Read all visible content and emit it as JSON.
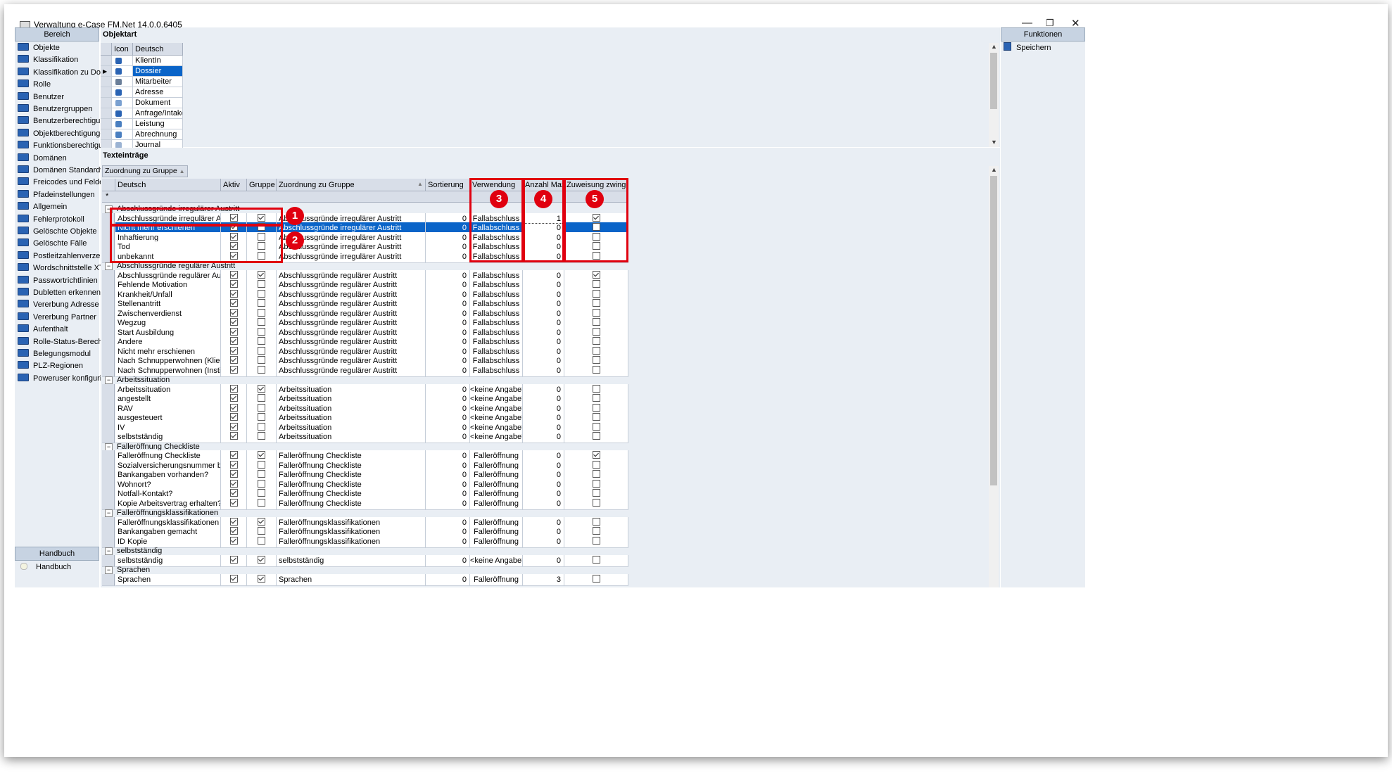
{
  "window": {
    "title": "Verwaltung e-Case FM.Net 14.0.0.6405",
    "minimize": "—",
    "restore": "❐",
    "close": "✕"
  },
  "left_panel": {
    "header": "Bereich",
    "items": [
      "Objekte",
      "Klassifikation",
      "Klassifikation zu Domä...",
      "Rolle",
      "Benutzer",
      "Benutzergruppen",
      "Benutzerberechtigungen",
      "Objektberechtigungen",
      "Funktionsberechtigung...",
      "Domänen",
      "Domänen Standardwe...",
      "Freicodes und Felder",
      "Pfadeinstellungen",
      "Allgemein",
      "Fehlerprotokoll",
      "Gelöschte Objekte",
      "Gelöschte Fälle",
      "Postleitzahlenverzeich...",
      "Wordschnittstelle XT",
      "Passwortrichtlinien",
      "Dubletten erkennen",
      "Vererbung Adresse",
      "Vererbung Partner",
      "Aufenthalt",
      "Rolle-Status-Berechnu...",
      "Belegungsmodul",
      "PLZ-Regionen",
      "Poweruser konfigurieren"
    ],
    "handbook_header": "Handbuch",
    "handbook_item": "Handbuch"
  },
  "right_panel": {
    "header": "Funktionen",
    "save": "Speichern"
  },
  "objektart": {
    "title": "Objektart",
    "columns": [
      "Icon",
      "Deutsch"
    ],
    "rows": [
      {
        "label": "KlientIn",
        "icon": "person-icon"
      },
      {
        "label": "Dossier",
        "icon": "folder-icon",
        "selected": true
      },
      {
        "label": "Mitarbeiter",
        "icon": "employee-icon"
      },
      {
        "label": "Adresse",
        "icon": "address-icon"
      },
      {
        "label": "Dokument",
        "icon": "document-icon"
      },
      {
        "label": "Anfrage/Intake",
        "icon": "pencil-icon"
      },
      {
        "label": "Leistung",
        "icon": "service-icon"
      },
      {
        "label": "Abrechnung",
        "icon": "billing-icon"
      },
      {
        "label": "Journal",
        "icon": "journal-icon"
      }
    ]
  },
  "texteintraege": {
    "title": "Texteinträge",
    "group_chip": "Zuordnung zu Gruppe",
    "new_row_marker": "*",
    "columns": [
      "Deutsch",
      "Aktiv",
      "Gruppe",
      "Zuordnung zu Gruppe",
      "Sortierung",
      "Verwendung",
      "Anzahl Max",
      "Zuweisung zwingend"
    ],
    "groups": [
      {
        "name": "Abschlussgründe irregulärer Austritt",
        "rows": [
          {
            "d": "Abschlussgründe irregulärer Austritt",
            "a": true,
            "g": true,
            "z": "Abschlussgründe irregulärer Austritt",
            "s": "0",
            "v": "Fallabschluss",
            "m": "1",
            "zw": true
          },
          {
            "d": "Nicht mehr erschienen",
            "a": true,
            "g": false,
            "z": "Abschlussgründe irregulärer Austritt",
            "s": "0",
            "v": "Fallabschluss",
            "m": "0",
            "zw": false,
            "selected": true
          },
          {
            "d": "Inhaftierung",
            "a": true,
            "g": false,
            "z": "Abschlussgründe irregulärer Austritt",
            "s": "0",
            "v": "Fallabschluss",
            "m": "0",
            "zw": false
          },
          {
            "d": "Tod",
            "a": true,
            "g": false,
            "z": "Abschlussgründe irregulärer Austritt",
            "s": "0",
            "v": "Fallabschluss",
            "m": "0",
            "zw": false
          },
          {
            "d": "unbekannt",
            "a": true,
            "g": false,
            "z": "Abschlussgründe irregulärer Austritt",
            "s": "0",
            "v": "Fallabschluss",
            "m": "0",
            "zw": false
          }
        ]
      },
      {
        "name": "Abschlussgründe regulärer Austritt",
        "rows": [
          {
            "d": "Abschlussgründe regulärer Austritt",
            "a": true,
            "g": true,
            "z": "Abschlussgründe regulärer Austritt",
            "s": "0",
            "v": "Fallabschluss",
            "m": "0",
            "zw": true
          },
          {
            "d": "Fehlende Motivation",
            "a": true,
            "g": false,
            "z": "Abschlussgründe regulärer Austritt",
            "s": "0",
            "v": "Fallabschluss",
            "m": "0",
            "zw": false
          },
          {
            "d": "Krankheit/Unfall",
            "a": true,
            "g": false,
            "z": "Abschlussgründe regulärer Austritt",
            "s": "0",
            "v": "Fallabschluss",
            "m": "0",
            "zw": false
          },
          {
            "d": "Stellenantritt",
            "a": true,
            "g": false,
            "z": "Abschlussgründe regulärer Austritt",
            "s": "0",
            "v": "Fallabschluss",
            "m": "0",
            "zw": false
          },
          {
            "d": "Zwischenverdienst",
            "a": true,
            "g": false,
            "z": "Abschlussgründe regulärer Austritt",
            "s": "0",
            "v": "Fallabschluss",
            "m": "0",
            "zw": false
          },
          {
            "d": "Wegzug",
            "a": true,
            "g": false,
            "z": "Abschlussgründe regulärer Austritt",
            "s": "0",
            "v": "Fallabschluss",
            "m": "0",
            "zw": false
          },
          {
            "d": "Start Ausbildung",
            "a": true,
            "g": false,
            "z": "Abschlussgründe regulärer Austritt",
            "s": "0",
            "v": "Fallabschluss",
            "m": "0",
            "zw": false
          },
          {
            "d": "Andere",
            "a": true,
            "g": false,
            "z": "Abschlussgründe regulärer Austritt",
            "s": "0",
            "v": "Fallabschluss",
            "m": "0",
            "zw": false
          },
          {
            "d": "Nicht mehr erschienen",
            "a": true,
            "g": false,
            "z": "Abschlussgründe regulärer Austritt",
            "s": "0",
            "v": "Fallabschluss",
            "m": "0",
            "zw": false
          },
          {
            "d": "Nach Schnupperwohnen (KlientIn)",
            "a": true,
            "g": false,
            "z": "Abschlussgründe regulärer Austritt",
            "s": "0",
            "v": "Fallabschluss",
            "m": "0",
            "zw": false
          },
          {
            "d": "Nach Schnupperwohnen (Institution)",
            "a": true,
            "g": false,
            "z": "Abschlussgründe regulärer Austritt",
            "s": "0",
            "v": "Fallabschluss",
            "m": "0",
            "zw": false
          }
        ]
      },
      {
        "name": "Arbeitssituation",
        "rows": [
          {
            "d": "Arbeitssituation",
            "a": true,
            "g": true,
            "z": "Arbeitssituation",
            "s": "0",
            "v": "<keine Angabe>",
            "m": "0",
            "zw": false
          },
          {
            "d": "angestellt",
            "a": true,
            "g": false,
            "z": "Arbeitssituation",
            "s": "0",
            "v": "<keine Angabe>",
            "m": "0",
            "zw": false
          },
          {
            "d": "RAV",
            "a": true,
            "g": false,
            "z": "Arbeitssituation",
            "s": "0",
            "v": "<keine Angabe>",
            "m": "0",
            "zw": false
          },
          {
            "d": "ausgesteuert",
            "a": true,
            "g": false,
            "z": "Arbeitssituation",
            "s": "0",
            "v": "<keine Angabe>",
            "m": "0",
            "zw": false
          },
          {
            "d": "IV",
            "a": true,
            "g": false,
            "z": "Arbeitssituation",
            "s": "0",
            "v": "<keine Angabe>",
            "m": "0",
            "zw": false
          },
          {
            "d": "selbstständig",
            "a": true,
            "g": false,
            "z": "Arbeitssituation",
            "s": "0",
            "v": "<keine Angabe>",
            "m": "0",
            "zw": false
          }
        ]
      },
      {
        "name": "Falleröffnung Checkliste",
        "rows": [
          {
            "d": "Falleröffnung Checkliste",
            "a": true,
            "g": true,
            "z": "Falleröffnung Checkliste",
            "s": "0",
            "v": "Falleröffnung",
            "m": "0",
            "zw": true
          },
          {
            "d": "Sozialversicherungsnummer bekannt?",
            "a": true,
            "g": false,
            "z": "Falleröffnung Checkliste",
            "s": "0",
            "v": "Falleröffnung",
            "m": "0",
            "zw": false
          },
          {
            "d": "Bankangaben vorhanden?",
            "a": true,
            "g": false,
            "z": "Falleröffnung Checkliste",
            "s": "0",
            "v": "Falleröffnung",
            "m": "0",
            "zw": false
          },
          {
            "d": "Wohnort?",
            "a": true,
            "g": false,
            "z": "Falleröffnung Checkliste",
            "s": "0",
            "v": "Falleröffnung",
            "m": "0",
            "zw": false
          },
          {
            "d": "Notfall-Kontakt?",
            "a": true,
            "g": false,
            "z": "Falleröffnung Checkliste",
            "s": "0",
            "v": "Falleröffnung",
            "m": "0",
            "zw": false
          },
          {
            "d": "Kopie Arbeitsvertrag erhalten?",
            "a": true,
            "g": false,
            "z": "Falleröffnung Checkliste",
            "s": "0",
            "v": "Falleröffnung",
            "m": "0",
            "zw": false
          }
        ]
      },
      {
        "name": "Falleröffnungsklassifikationen",
        "rows": [
          {
            "d": "Falleröffnungsklassifikationen",
            "a": true,
            "g": true,
            "z": "Falleröffnungsklassifikationen",
            "s": "0",
            "v": "Falleröffnung",
            "m": "0",
            "zw": false
          },
          {
            "d": "Bankangaben gemacht",
            "a": true,
            "g": false,
            "z": "Falleröffnungsklassifikationen",
            "s": "0",
            "v": "Falleröffnung",
            "m": "0",
            "zw": false
          },
          {
            "d": "ID Kopie",
            "a": true,
            "g": false,
            "z": "Falleröffnungsklassifikationen",
            "s": "0",
            "v": "Falleröffnung",
            "m": "0",
            "zw": false
          }
        ]
      },
      {
        "name": "selbstständig",
        "rows": [
          {
            "d": "selbstständig",
            "a": true,
            "g": true,
            "z": "selbstständig",
            "s": "0",
            "v": "<keine Angabe>",
            "m": "0",
            "zw": false
          }
        ]
      },
      {
        "name": "Sprachen",
        "rows": [
          {
            "d": "Sprachen",
            "a": true,
            "g": true,
            "z": "Sprachen",
            "s": "0",
            "v": "Falleröffnung",
            "m": "3",
            "zw": false
          }
        ]
      }
    ]
  },
  "annotations": {
    "badges": [
      "1",
      "2",
      "3",
      "4",
      "5"
    ],
    "box_color": "#e0000f"
  }
}
